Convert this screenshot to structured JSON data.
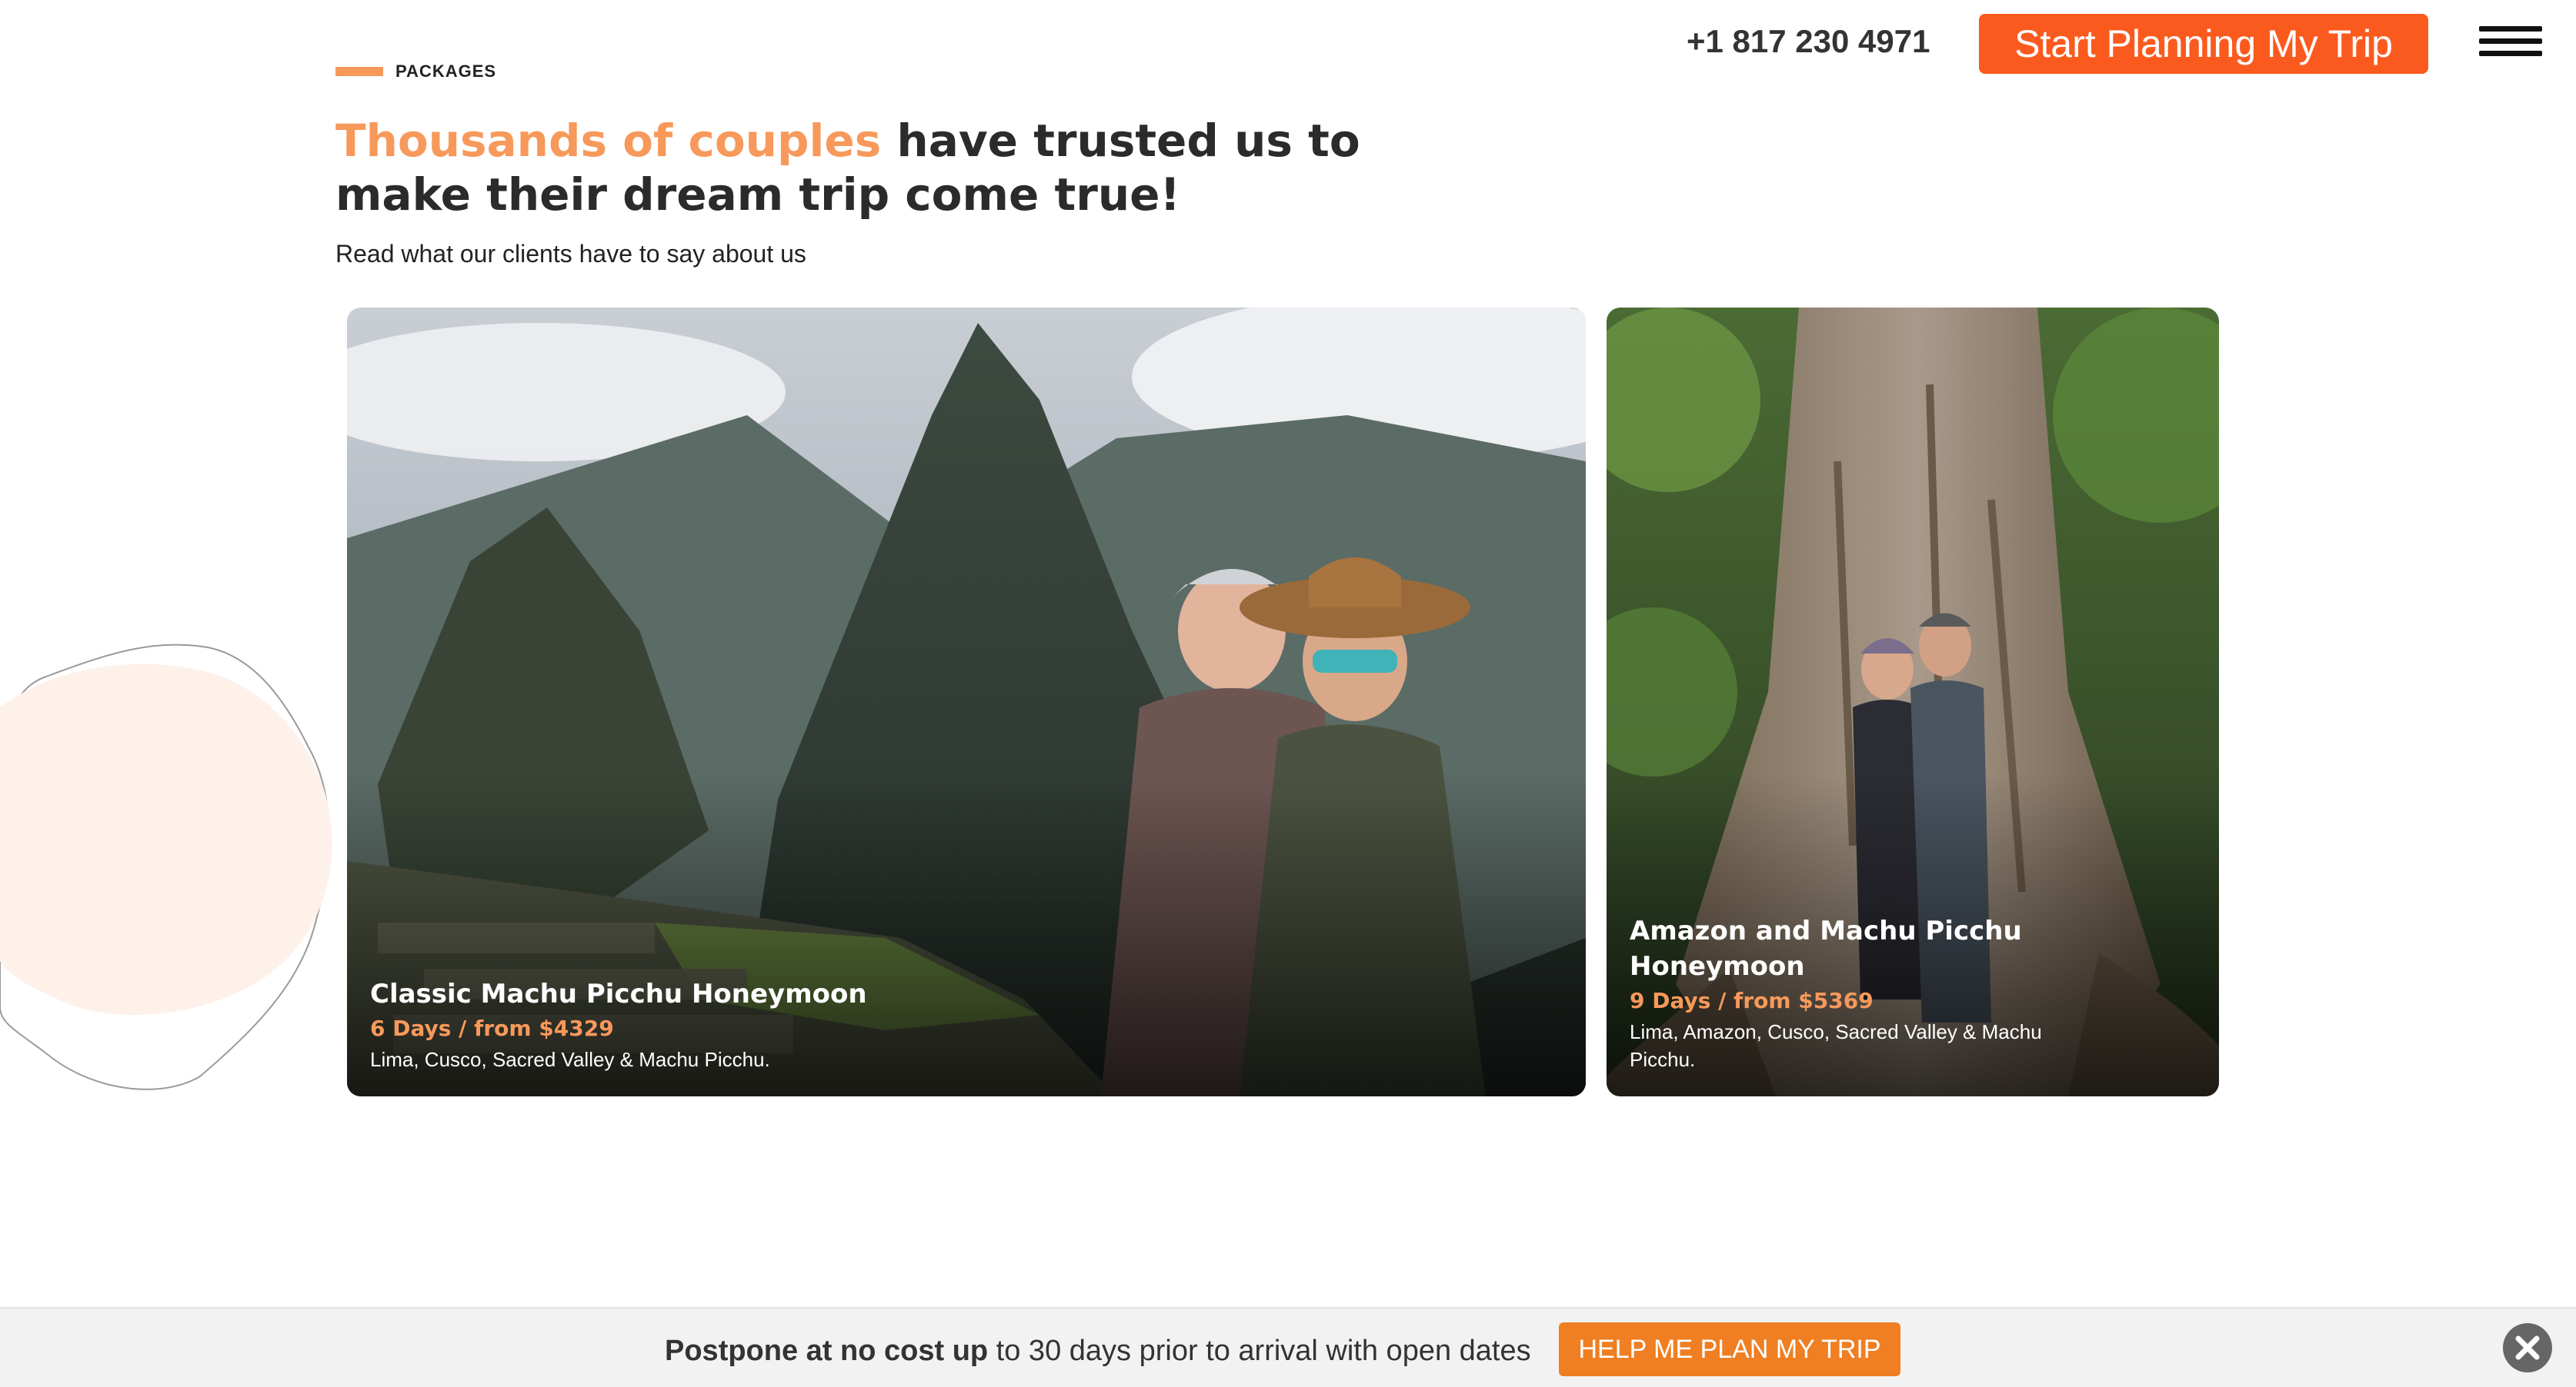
{
  "header": {
    "phone": "+1 817 230 4971",
    "cta_label": "Start Planning My Trip",
    "menu_icon": "hamburger-menu-icon"
  },
  "intro": {
    "eyebrow": "PACKAGES",
    "headline_accent": "Thousands of couples",
    "headline_rest": " have trusted us to make their dream trip come true!",
    "subline": "Read what our clients have to say about us"
  },
  "cards": [
    {
      "title": "Classic Machu Picchu Honeymoon",
      "price": "6 Days / from $4329",
      "places": "Lima, Cusco, Sacred Valley & Machu Picchu."
    },
    {
      "title": "Amazon and Machu Picchu Honeymoon",
      "price": "9 Days / from $5369",
      "places": "Lima, Amazon, Cusco, Sacred Valley & Machu Picchu."
    }
  ],
  "bottom_bar": {
    "bold_text": "Postpone at no cost up",
    "rest_text": " to 30 days prior to arrival with open dates",
    "cta_label": "HELP ME PLAN MY TRIP",
    "close_icon": "close-icon"
  },
  "colors": {
    "accent": "#f7995a",
    "cta_top": "#fb5a1e",
    "cta_bottom": "#ef7f22"
  }
}
